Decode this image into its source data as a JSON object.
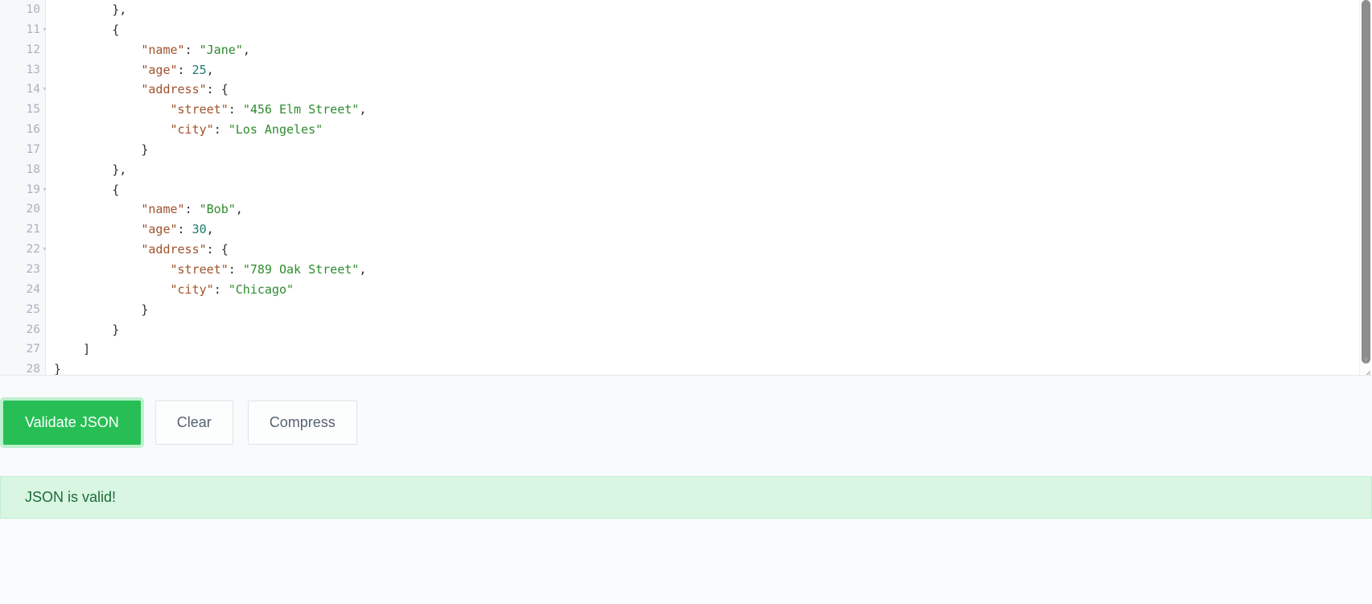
{
  "editor": {
    "name": "json-editor",
    "first_line_number": 10,
    "visible_lines": [
      {
        "num": "10",
        "fold": false,
        "tokens": [
          {
            "t": "p",
            "v": "        },"
          }
        ]
      },
      {
        "num": "11",
        "fold": true,
        "tokens": [
          {
            "t": "p",
            "v": "        {"
          }
        ]
      },
      {
        "num": "12",
        "fold": false,
        "tokens": [
          {
            "t": "k",
            "v": "            \"name\""
          },
          {
            "t": "p",
            "v": ": "
          },
          {
            "t": "s",
            "v": "\"Jane\""
          },
          {
            "t": "p",
            "v": ","
          }
        ]
      },
      {
        "num": "13",
        "fold": false,
        "tokens": [
          {
            "t": "k",
            "v": "            \"age\""
          },
          {
            "t": "p",
            "v": ": "
          },
          {
            "t": "n",
            "v": "25"
          },
          {
            "t": "p",
            "v": ","
          }
        ]
      },
      {
        "num": "14",
        "fold": true,
        "tokens": [
          {
            "t": "k",
            "v": "            \"address\""
          },
          {
            "t": "p",
            "v": ": {"
          }
        ]
      },
      {
        "num": "15",
        "fold": false,
        "tokens": [
          {
            "t": "k",
            "v": "                \"street\""
          },
          {
            "t": "p",
            "v": ": "
          },
          {
            "t": "s",
            "v": "\"456 Elm Street\""
          },
          {
            "t": "p",
            "v": ","
          }
        ]
      },
      {
        "num": "16",
        "fold": false,
        "tokens": [
          {
            "t": "k",
            "v": "                \"city\""
          },
          {
            "t": "p",
            "v": ": "
          },
          {
            "t": "s",
            "v": "\"Los Angeles\""
          }
        ]
      },
      {
        "num": "17",
        "fold": false,
        "tokens": [
          {
            "t": "p",
            "v": "            }"
          }
        ]
      },
      {
        "num": "18",
        "fold": false,
        "tokens": [
          {
            "t": "p",
            "v": "        },"
          }
        ]
      },
      {
        "num": "19",
        "fold": true,
        "tokens": [
          {
            "t": "p",
            "v": "        {"
          }
        ]
      },
      {
        "num": "20",
        "fold": false,
        "tokens": [
          {
            "t": "k",
            "v": "            \"name\""
          },
          {
            "t": "p",
            "v": ": "
          },
          {
            "t": "s",
            "v": "\"Bob\""
          },
          {
            "t": "p",
            "v": ","
          }
        ]
      },
      {
        "num": "21",
        "fold": false,
        "tokens": [
          {
            "t": "k",
            "v": "            \"age\""
          },
          {
            "t": "p",
            "v": ": "
          },
          {
            "t": "n",
            "v": "30"
          },
          {
            "t": "p",
            "v": ","
          }
        ]
      },
      {
        "num": "22",
        "fold": true,
        "tokens": [
          {
            "t": "k",
            "v": "            \"address\""
          },
          {
            "t": "p",
            "v": ": {"
          }
        ]
      },
      {
        "num": "23",
        "fold": false,
        "tokens": [
          {
            "t": "k",
            "v": "                \"street\""
          },
          {
            "t": "p",
            "v": ": "
          },
          {
            "t": "s",
            "v": "\"789 Oak Street\""
          },
          {
            "t": "p",
            "v": ","
          }
        ]
      },
      {
        "num": "24",
        "fold": false,
        "tokens": [
          {
            "t": "k",
            "v": "                \"city\""
          },
          {
            "t": "p",
            "v": ": "
          },
          {
            "t": "s",
            "v": "\"Chicago\""
          }
        ]
      },
      {
        "num": "25",
        "fold": false,
        "tokens": [
          {
            "t": "p",
            "v": "            }"
          }
        ]
      },
      {
        "num": "26",
        "fold": false,
        "tokens": [
          {
            "t": "p",
            "v": "        }"
          }
        ]
      },
      {
        "num": "27",
        "fold": false,
        "tokens": [
          {
            "t": "p",
            "v": "    ]"
          }
        ]
      },
      {
        "num": "28",
        "fold": false,
        "tokens": [
          {
            "t": "p",
            "v": "}"
          }
        ]
      }
    ],
    "fold_marker": "▾",
    "scrollbar": {
      "down_arrow": "▼"
    }
  },
  "toolbar": {
    "validate_label": "Validate JSON",
    "clear_label": "Clear",
    "compress_label": "Compress"
  },
  "alert": {
    "message": "JSON is valid!"
  },
  "colors": {
    "primary_button": "#27bf55",
    "focus_ring": "#bdf0cd",
    "alert_bg": "#d9f6e3",
    "alert_border": "#c4eed4",
    "alert_text": "#1d6b36",
    "json_key": "#a0522d",
    "json_string": "#2e8b2e",
    "json_number": "#1d7a6b",
    "json_punctuation": "#2b2f33",
    "gutter_bg": "#f6f8fa",
    "line_number": "#aab2bd"
  }
}
